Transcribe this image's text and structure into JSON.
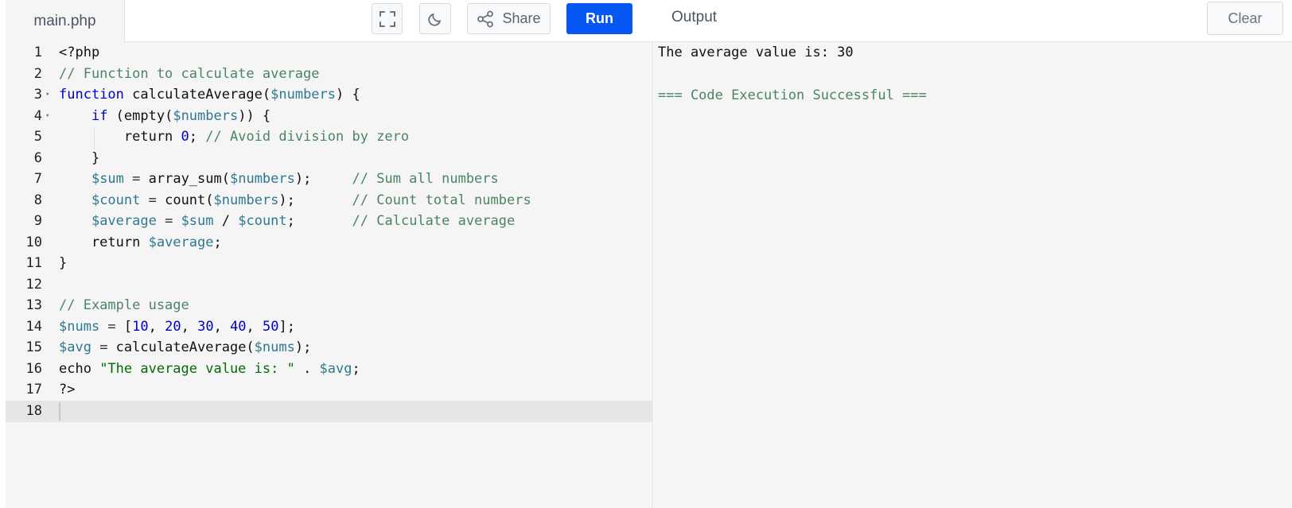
{
  "editor": {
    "file_tab": "main.php",
    "share_label": "Share",
    "run_label": "Run",
    "icons": {
      "fullscreen": "fullscreen-icon",
      "theme": "moon-icon",
      "share": "share-icon"
    },
    "lines": [
      {
        "n": "1",
        "fold": false,
        "tokens": [
          [
            "plain",
            "<?php"
          ]
        ]
      },
      {
        "n": "2",
        "fold": false,
        "tokens": [
          [
            "cm",
            "// Function to calculate average"
          ]
        ]
      },
      {
        "n": "3",
        "fold": true,
        "tokens": [
          [
            "kw",
            "function"
          ],
          [
            "plain",
            " calculateAverage("
          ],
          [
            "var",
            "$numbers"
          ],
          [
            "plain",
            ") {"
          ]
        ]
      },
      {
        "n": "4",
        "fold": true,
        "tokens": [
          [
            "plain",
            "    "
          ],
          [
            "kw",
            "if"
          ],
          [
            "plain",
            " (empty("
          ],
          [
            "var",
            "$numbers"
          ],
          [
            "plain",
            ")) {"
          ]
        ]
      },
      {
        "n": "5",
        "fold": false,
        "tokens": [
          [
            "plain",
            "        return "
          ],
          [
            "num",
            "0"
          ],
          [
            "plain",
            "; "
          ],
          [
            "cm",
            "// Avoid division by zero"
          ]
        ]
      },
      {
        "n": "6",
        "fold": false,
        "tokens": [
          [
            "plain",
            "    }"
          ]
        ]
      },
      {
        "n": "7",
        "fold": false,
        "tokens": [
          [
            "plain",
            "    "
          ],
          [
            "var",
            "$sum"
          ],
          [
            "op",
            " = "
          ],
          [
            "plain",
            "array_sum("
          ],
          [
            "var",
            "$numbers"
          ],
          [
            "plain",
            ");     "
          ],
          [
            "cm",
            "// Sum all numbers"
          ]
        ]
      },
      {
        "n": "8",
        "fold": false,
        "tokens": [
          [
            "plain",
            "    "
          ],
          [
            "var",
            "$count"
          ],
          [
            "op",
            " = "
          ],
          [
            "plain",
            "count("
          ],
          [
            "var",
            "$numbers"
          ],
          [
            "plain",
            ");       "
          ],
          [
            "cm",
            "// Count total numbers"
          ]
        ]
      },
      {
        "n": "9",
        "fold": false,
        "tokens": [
          [
            "plain",
            "    "
          ],
          [
            "var",
            "$average"
          ],
          [
            "op",
            " = "
          ],
          [
            "var",
            "$sum"
          ],
          [
            "plain",
            " / "
          ],
          [
            "var",
            "$count"
          ],
          [
            "plain",
            ";       "
          ],
          [
            "cm",
            "// Calculate average"
          ]
        ]
      },
      {
        "n": "10",
        "fold": false,
        "tokens": [
          [
            "plain",
            "    return "
          ],
          [
            "var",
            "$average"
          ],
          [
            "plain",
            ";"
          ]
        ]
      },
      {
        "n": "11",
        "fold": false,
        "tokens": [
          [
            "plain",
            "}"
          ]
        ]
      },
      {
        "n": "12",
        "fold": false,
        "tokens": []
      },
      {
        "n": "13",
        "fold": false,
        "tokens": [
          [
            "cm",
            "// Example usage"
          ]
        ]
      },
      {
        "n": "14",
        "fold": false,
        "tokens": [
          [
            "var",
            "$nums"
          ],
          [
            "op",
            " = "
          ],
          [
            "plain",
            "["
          ],
          [
            "num",
            "10"
          ],
          [
            "plain",
            ", "
          ],
          [
            "num",
            "20"
          ],
          [
            "plain",
            ", "
          ],
          [
            "num",
            "30"
          ],
          [
            "plain",
            ", "
          ],
          [
            "num",
            "40"
          ],
          [
            "plain",
            ", "
          ],
          [
            "num",
            "50"
          ],
          [
            "plain",
            "];"
          ]
        ]
      },
      {
        "n": "15",
        "fold": false,
        "tokens": [
          [
            "var",
            "$avg"
          ],
          [
            "op",
            " = "
          ],
          [
            "plain",
            "calculateAverage("
          ],
          [
            "var",
            "$nums"
          ],
          [
            "plain",
            ");"
          ]
        ]
      },
      {
        "n": "16",
        "fold": false,
        "tokens": [
          [
            "plain",
            "echo "
          ],
          [
            "str",
            "\"The average value is: \""
          ],
          [
            "plain",
            " . "
          ],
          [
            "var",
            "$avg"
          ],
          [
            "plain",
            ";"
          ]
        ]
      },
      {
        "n": "17",
        "fold": false,
        "tokens": [
          [
            "plain",
            "?>"
          ]
        ]
      },
      {
        "n": "18",
        "fold": false,
        "tokens": [],
        "active": true
      }
    ]
  },
  "output": {
    "title": "Output",
    "clear_label": "Clear",
    "lines": [
      {
        "text": "The average value is: 30",
        "kind": "normal"
      },
      {
        "text": "",
        "kind": "normal"
      },
      {
        "text": "=== Code Execution Successful ===",
        "kind": "success"
      }
    ]
  },
  "colors": {
    "run_button": "#0556f3",
    "keyword": "#0000cc",
    "variable": "#2f7891",
    "comment": "#4b8463",
    "string": "#036a07"
  }
}
